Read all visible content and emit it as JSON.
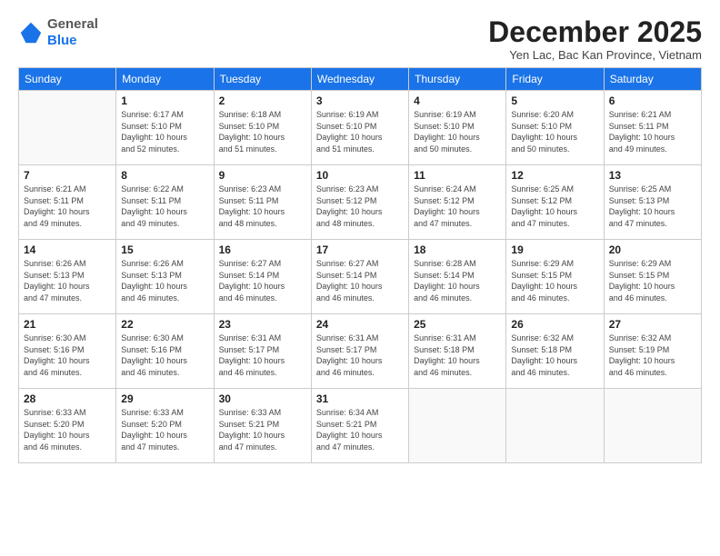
{
  "header": {
    "logo": {
      "general": "General",
      "blue": "Blue"
    },
    "title": "December 2025",
    "location": "Yen Lac, Bac Kan Province, Vietnam"
  },
  "calendar": {
    "days_of_week": [
      "Sunday",
      "Monday",
      "Tuesday",
      "Wednesday",
      "Thursday",
      "Friday",
      "Saturday"
    ],
    "weeks": [
      [
        {
          "day": "",
          "info": ""
        },
        {
          "day": "1",
          "info": "Sunrise: 6:17 AM\nSunset: 5:10 PM\nDaylight: 10 hours\nand 52 minutes."
        },
        {
          "day": "2",
          "info": "Sunrise: 6:18 AM\nSunset: 5:10 PM\nDaylight: 10 hours\nand 51 minutes."
        },
        {
          "day": "3",
          "info": "Sunrise: 6:19 AM\nSunset: 5:10 PM\nDaylight: 10 hours\nand 51 minutes."
        },
        {
          "day": "4",
          "info": "Sunrise: 6:19 AM\nSunset: 5:10 PM\nDaylight: 10 hours\nand 50 minutes."
        },
        {
          "day": "5",
          "info": "Sunrise: 6:20 AM\nSunset: 5:10 PM\nDaylight: 10 hours\nand 50 minutes."
        },
        {
          "day": "6",
          "info": "Sunrise: 6:21 AM\nSunset: 5:11 PM\nDaylight: 10 hours\nand 49 minutes."
        }
      ],
      [
        {
          "day": "7",
          "info": "Sunrise: 6:21 AM\nSunset: 5:11 PM\nDaylight: 10 hours\nand 49 minutes."
        },
        {
          "day": "8",
          "info": "Sunrise: 6:22 AM\nSunset: 5:11 PM\nDaylight: 10 hours\nand 49 minutes."
        },
        {
          "day": "9",
          "info": "Sunrise: 6:23 AM\nSunset: 5:11 PM\nDaylight: 10 hours\nand 48 minutes."
        },
        {
          "day": "10",
          "info": "Sunrise: 6:23 AM\nSunset: 5:12 PM\nDaylight: 10 hours\nand 48 minutes."
        },
        {
          "day": "11",
          "info": "Sunrise: 6:24 AM\nSunset: 5:12 PM\nDaylight: 10 hours\nand 47 minutes."
        },
        {
          "day": "12",
          "info": "Sunrise: 6:25 AM\nSunset: 5:12 PM\nDaylight: 10 hours\nand 47 minutes."
        },
        {
          "day": "13",
          "info": "Sunrise: 6:25 AM\nSunset: 5:13 PM\nDaylight: 10 hours\nand 47 minutes."
        }
      ],
      [
        {
          "day": "14",
          "info": "Sunrise: 6:26 AM\nSunset: 5:13 PM\nDaylight: 10 hours\nand 47 minutes."
        },
        {
          "day": "15",
          "info": "Sunrise: 6:26 AM\nSunset: 5:13 PM\nDaylight: 10 hours\nand 46 minutes."
        },
        {
          "day": "16",
          "info": "Sunrise: 6:27 AM\nSunset: 5:14 PM\nDaylight: 10 hours\nand 46 minutes."
        },
        {
          "day": "17",
          "info": "Sunrise: 6:27 AM\nSunset: 5:14 PM\nDaylight: 10 hours\nand 46 minutes."
        },
        {
          "day": "18",
          "info": "Sunrise: 6:28 AM\nSunset: 5:14 PM\nDaylight: 10 hours\nand 46 minutes."
        },
        {
          "day": "19",
          "info": "Sunrise: 6:29 AM\nSunset: 5:15 PM\nDaylight: 10 hours\nand 46 minutes."
        },
        {
          "day": "20",
          "info": "Sunrise: 6:29 AM\nSunset: 5:15 PM\nDaylight: 10 hours\nand 46 minutes."
        }
      ],
      [
        {
          "day": "21",
          "info": "Sunrise: 6:30 AM\nSunset: 5:16 PM\nDaylight: 10 hours\nand 46 minutes."
        },
        {
          "day": "22",
          "info": "Sunrise: 6:30 AM\nSunset: 5:16 PM\nDaylight: 10 hours\nand 46 minutes."
        },
        {
          "day": "23",
          "info": "Sunrise: 6:31 AM\nSunset: 5:17 PM\nDaylight: 10 hours\nand 46 minutes."
        },
        {
          "day": "24",
          "info": "Sunrise: 6:31 AM\nSunset: 5:17 PM\nDaylight: 10 hours\nand 46 minutes."
        },
        {
          "day": "25",
          "info": "Sunrise: 6:31 AM\nSunset: 5:18 PM\nDaylight: 10 hours\nand 46 minutes."
        },
        {
          "day": "26",
          "info": "Sunrise: 6:32 AM\nSunset: 5:18 PM\nDaylight: 10 hours\nand 46 minutes."
        },
        {
          "day": "27",
          "info": "Sunrise: 6:32 AM\nSunset: 5:19 PM\nDaylight: 10 hours\nand 46 minutes."
        }
      ],
      [
        {
          "day": "28",
          "info": "Sunrise: 6:33 AM\nSunset: 5:20 PM\nDaylight: 10 hours\nand 46 minutes."
        },
        {
          "day": "29",
          "info": "Sunrise: 6:33 AM\nSunset: 5:20 PM\nDaylight: 10 hours\nand 47 minutes."
        },
        {
          "day": "30",
          "info": "Sunrise: 6:33 AM\nSunset: 5:21 PM\nDaylight: 10 hours\nand 47 minutes."
        },
        {
          "day": "31",
          "info": "Sunrise: 6:34 AM\nSunset: 5:21 PM\nDaylight: 10 hours\nand 47 minutes."
        },
        {
          "day": "",
          "info": ""
        },
        {
          "day": "",
          "info": ""
        },
        {
          "day": "",
          "info": ""
        }
      ]
    ]
  }
}
